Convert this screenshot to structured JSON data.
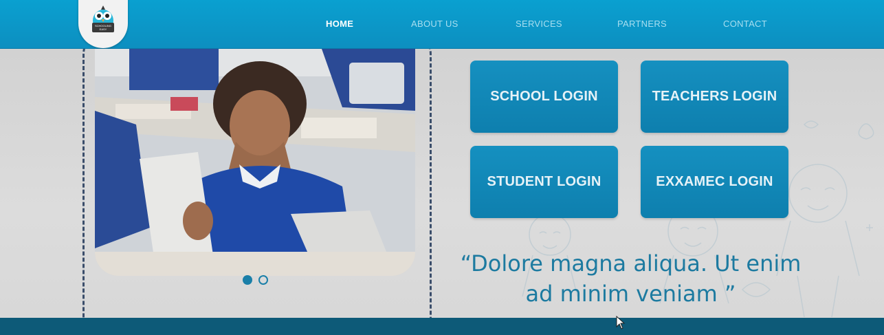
{
  "header": {
    "logo_text": "SCHOOLING EASY",
    "nav": [
      {
        "label": "HOME",
        "active": true
      },
      {
        "label": "ABOUT US",
        "active": false
      },
      {
        "label": "SERVICES",
        "active": false
      },
      {
        "label": "PARTNERS",
        "active": false
      },
      {
        "label": "CONTACT",
        "active": false
      }
    ]
  },
  "logins": {
    "school": "SCHOOL LOGIN",
    "teachers": "TEACHERS LOGIN",
    "student": "STUDENT LOGIN",
    "exxamec": "EXXAMEC LOGIN"
  },
  "quote": "“Dolore magna aliqua. Ut enim ad minim veniam ”",
  "slider": {
    "current_slide": 1,
    "total_slides": 2,
    "photo_description": "child-with-tablet-in-classroom"
  },
  "colors": {
    "header": "#0d8fc0",
    "button": "#1287b6",
    "quote": "#1c7aa0",
    "footer": "#0d5a78",
    "nav_inactive": "#a9dff0"
  }
}
